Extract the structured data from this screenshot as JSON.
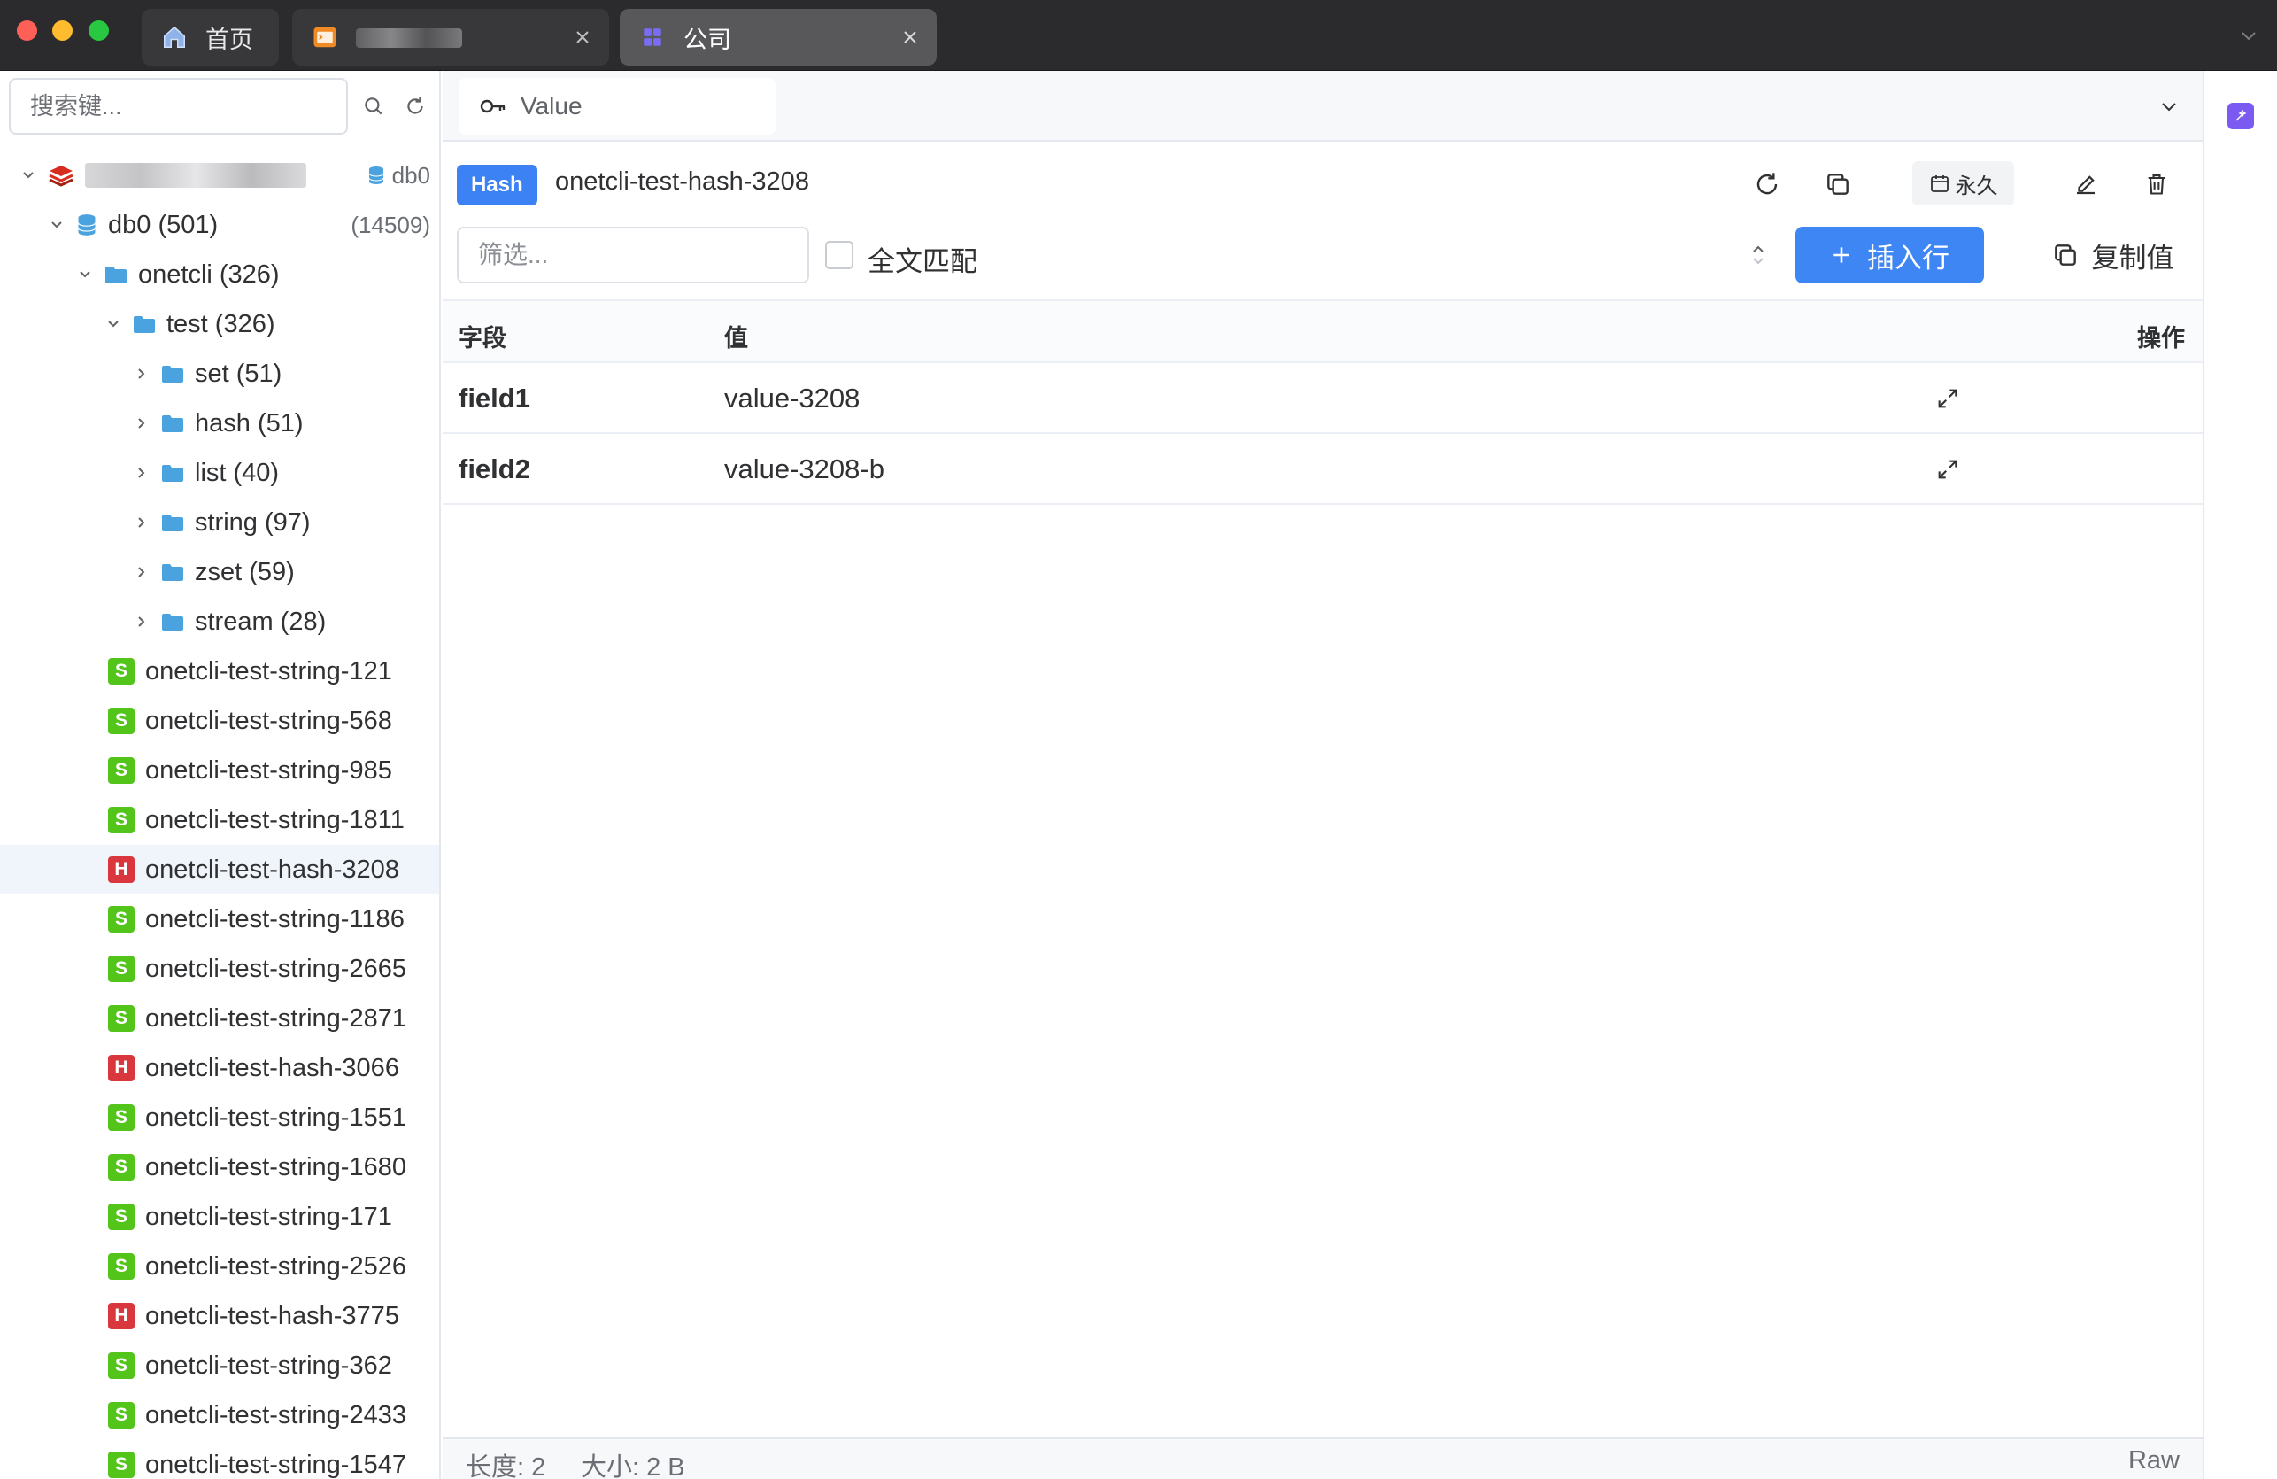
{
  "tabs": [
    {
      "label": "首页",
      "icon": "home-icon"
    },
    {
      "label": "",
      "icon": "terminal-icon",
      "blurred": true
    },
    {
      "label": "公司",
      "icon": "grid-icon"
    }
  ],
  "sidebar": {
    "search_placeholder": "搜索键...",
    "connection": {
      "db_label": "db0"
    },
    "tree": [
      {
        "label": "db0 (501)",
        "count": "(14509)"
      },
      {
        "label": "onetcli (326)"
      },
      {
        "label": "test (326)"
      },
      {
        "label": "set (51)"
      },
      {
        "label": "hash (51)"
      },
      {
        "label": "list (40)"
      },
      {
        "label": "string (97)"
      },
      {
        "label": "zset (59)"
      },
      {
        "label": "stream (28)"
      }
    ],
    "keys": [
      {
        "type": "S",
        "name": "onetcli-test-string-121"
      },
      {
        "type": "S",
        "name": "onetcli-test-string-568"
      },
      {
        "type": "S",
        "name": "onetcli-test-string-985"
      },
      {
        "type": "S",
        "name": "onetcli-test-string-1811"
      },
      {
        "type": "H",
        "name": "onetcli-test-hash-3208",
        "selected": true
      },
      {
        "type": "S",
        "name": "onetcli-test-string-1186"
      },
      {
        "type": "S",
        "name": "onetcli-test-string-2665"
      },
      {
        "type": "S",
        "name": "onetcli-test-string-2871"
      },
      {
        "type": "H",
        "name": "onetcli-test-hash-3066"
      },
      {
        "type": "S",
        "name": "onetcli-test-string-1551"
      },
      {
        "type": "S",
        "name": "onetcli-test-string-1680"
      },
      {
        "type": "S",
        "name": "onetcli-test-string-171"
      },
      {
        "type": "S",
        "name": "onetcli-test-string-2526"
      },
      {
        "type": "H",
        "name": "onetcli-test-hash-3775"
      },
      {
        "type": "S",
        "name": "onetcli-test-string-362"
      },
      {
        "type": "S",
        "name": "onetcli-test-string-2433"
      },
      {
        "type": "S",
        "name": "onetcli-test-string-1547"
      }
    ]
  },
  "main": {
    "value_tab": "Value",
    "type_tag": "Hash",
    "key_name": "onetcli-test-hash-3208",
    "ttl_label": "永久",
    "filter_placeholder": "筛选...",
    "fulltext_label": "全文匹配",
    "insert_label": "插入行",
    "copy_label": "复制值",
    "columns": {
      "field": "字段",
      "value": "值",
      "actions": "操作"
    },
    "rows": [
      {
        "field": "field1",
        "value": "value-3208"
      },
      {
        "field": "field2",
        "value": "value-3208-b"
      }
    ],
    "status": {
      "length": "长度: 2",
      "size": "大小: 2 B",
      "format": "Raw"
    }
  },
  "colors": {
    "accent": "#3f86f5",
    "string_badge": "#52c41a",
    "hash_badge": "#d9363e",
    "folder": "#4aa3df"
  }
}
